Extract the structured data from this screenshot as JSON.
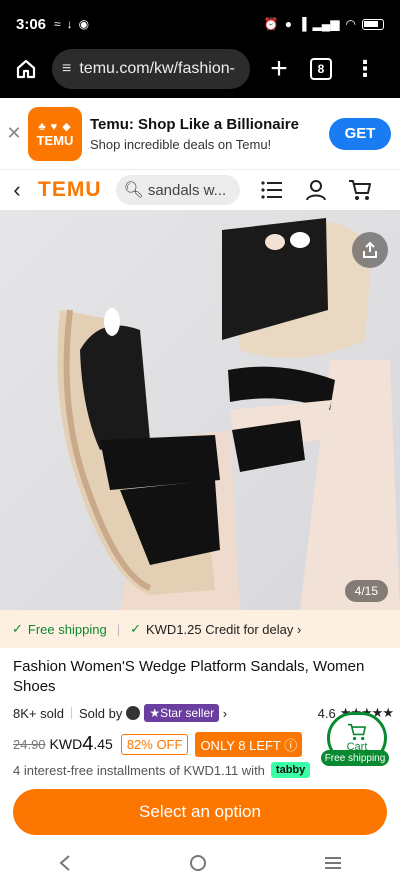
{
  "status_bar": {
    "time": "3:06"
  },
  "browser": {
    "url": "temu.com/kw/fashion-",
    "tab_count": "8"
  },
  "app_banner": {
    "logo_text": "TEMU",
    "title": "Temu: Shop Like a Billionaire",
    "subtitle": "Shop incredible deals on Temu!",
    "get_label": "GET"
  },
  "header": {
    "logo": "TEMU",
    "search_text": "sandals w..."
  },
  "image": {
    "counter": "4/15"
  },
  "shipping": {
    "free_label": "Free shipping",
    "credit_label": "KWD1.25 Credit for delay"
  },
  "product": {
    "title": "Fashion Women'S Wedge Platform Sandals, Women Shoes",
    "sold": "8K+ sold",
    "sold_by": "Sold by",
    "star_seller": "Star seller",
    "rating": "4.6",
    "old_price": "24.90",
    "currency": "KWD",
    "price_int": "4",
    "price_dec": ".45",
    "discount": "82% OFF",
    "stock": "ONLY 8 LEFT",
    "installments": "4 interest-free installments of KWD1.11 with",
    "installment_provider": "tabby"
  },
  "cart": {
    "label": "Cart",
    "free_shipping": "Free shipping"
  },
  "cta": {
    "label": "Select an option"
  },
  "colors": {
    "brand": "#fb7701",
    "success": "#0a8a30",
    "get_button": "#1a7cf3",
    "star_seller": "#6b3fa0"
  }
}
